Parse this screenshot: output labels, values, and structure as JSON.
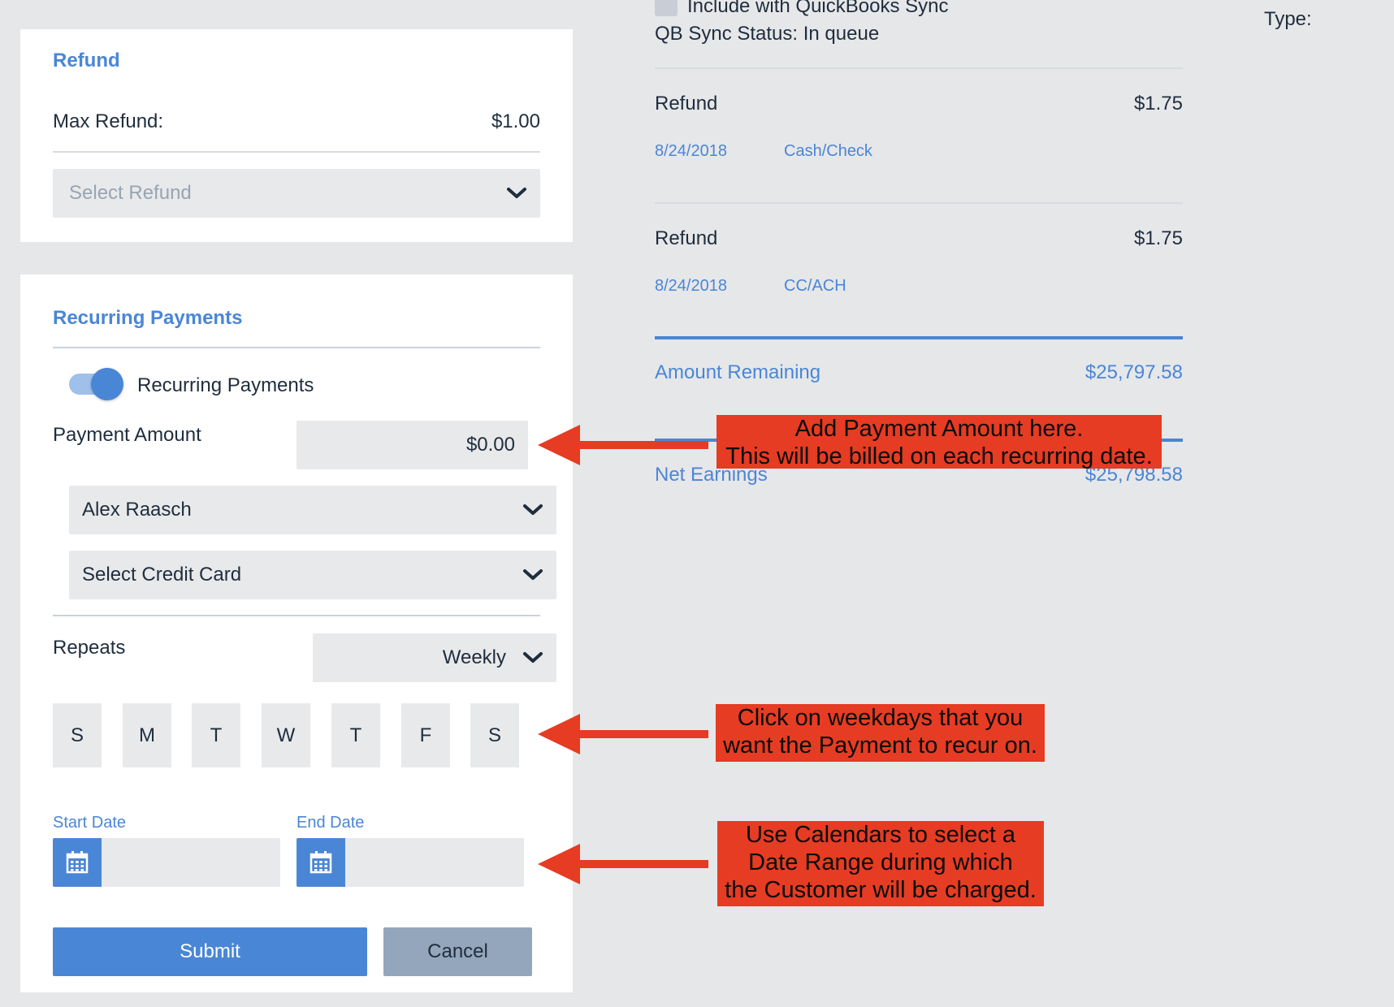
{
  "refund_card": {
    "title": "Refund",
    "max_label": "Max Refund:",
    "max_value": "$1.00",
    "select_placeholder": "Select Refund"
  },
  "recurring_card": {
    "title": "Recurring Payments",
    "toggle_label": "Recurring Payments",
    "toggle_on": true,
    "payment_amount_label": "Payment Amount",
    "payment_amount_value": "$0.00",
    "customer_select": "Alex Raasch",
    "card_select": "Select Credit Card",
    "repeats_label": "Repeats",
    "repeats_value": "Weekly",
    "days": [
      "S",
      "M",
      "T",
      "W",
      "T",
      "F",
      "S"
    ],
    "start_date_label": "Start Date",
    "end_date_label": "End Date",
    "submit_label": "Submit",
    "cancel_label": "Cancel"
  },
  "summary": {
    "qb_sync_label": "Include with QuickBooks Sync",
    "qb_status": "QB Sync Status: In queue",
    "type_label": "Type:",
    "transactions": [
      {
        "title": "Refund",
        "amount": "$1.75",
        "date": "8/24/2018",
        "method": "Cash/Check"
      },
      {
        "title": "Refund",
        "amount": "$1.75",
        "date": "8/24/2018",
        "method": "CC/ACH"
      }
    ],
    "amount_remaining_label": "Amount Remaining",
    "amount_remaining_value": "$25,797.58",
    "net_earnings_label": "Net Earnings",
    "net_earnings_value": "$25,798.58"
  },
  "annotations": {
    "payment_amount": [
      "Add Payment Amount here.",
      "This will be billed on each recurring date."
    ],
    "weekdays": [
      "Click on weekdays that you",
      "want the Payment to recur on."
    ],
    "calendars": [
      "Use Calendars to select a",
      "Date Range during which",
      "the Customer will be charged."
    ]
  },
  "colors": {
    "accent": "#4a86d6",
    "callout": "#e53c23",
    "arrow": "#e53c23",
    "background": "#e6e7e9"
  },
  "icons": [
    "chevron-down-icon",
    "calendar-icon",
    "arrow-left-icon"
  ]
}
